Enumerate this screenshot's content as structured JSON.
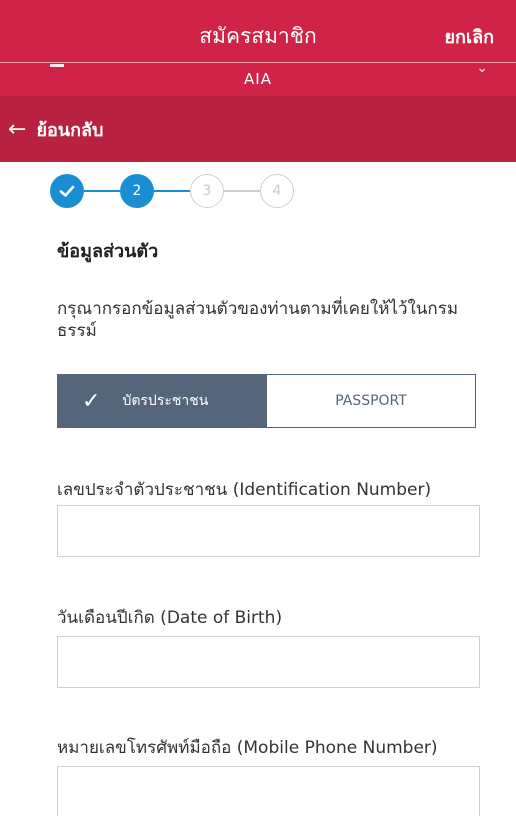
{
  "header": {
    "title": "สมัครสมาชิก",
    "cancel_label": "ยกเลิก",
    "sub_title": "AIA",
    "background_color": "#cf2447"
  },
  "back": {
    "arrow_icon": "arrow-left-icon",
    "label": "ย้อนกลับ",
    "background_color": "#b8213f"
  },
  "stepper": {
    "current_step": 2,
    "steps": [
      {
        "label": "",
        "state": "done",
        "icon": "check-icon"
      },
      {
        "label": "2",
        "state": "active"
      },
      {
        "label": "3",
        "state": "idle"
      },
      {
        "label": "4",
        "state": "idle"
      }
    ],
    "accent_color": "#1a8ed3"
  },
  "section": {
    "title": "ข้อมูลส่วนตัว",
    "instruction": "กรุณากรอกข้อมูลส่วนตัวของท่านตามที่เคยให้ไว้ในกรมธรรม์"
  },
  "id_type": {
    "options": [
      "บัตรประชาชน",
      "PASSPORT"
    ],
    "selected": "บัตรประชาชน",
    "selected_color": "#55667a"
  },
  "fields": [
    {
      "label": "เลขประจำตัวประชาชน (Identification Number)",
      "value": ""
    },
    {
      "label": "วันเดือนปีเกิด (Date of Birth)",
      "value": ""
    },
    {
      "label": "หมายเลขโทรศัพท์มือถือ (Mobile Phone Number)",
      "value": ""
    }
  ]
}
